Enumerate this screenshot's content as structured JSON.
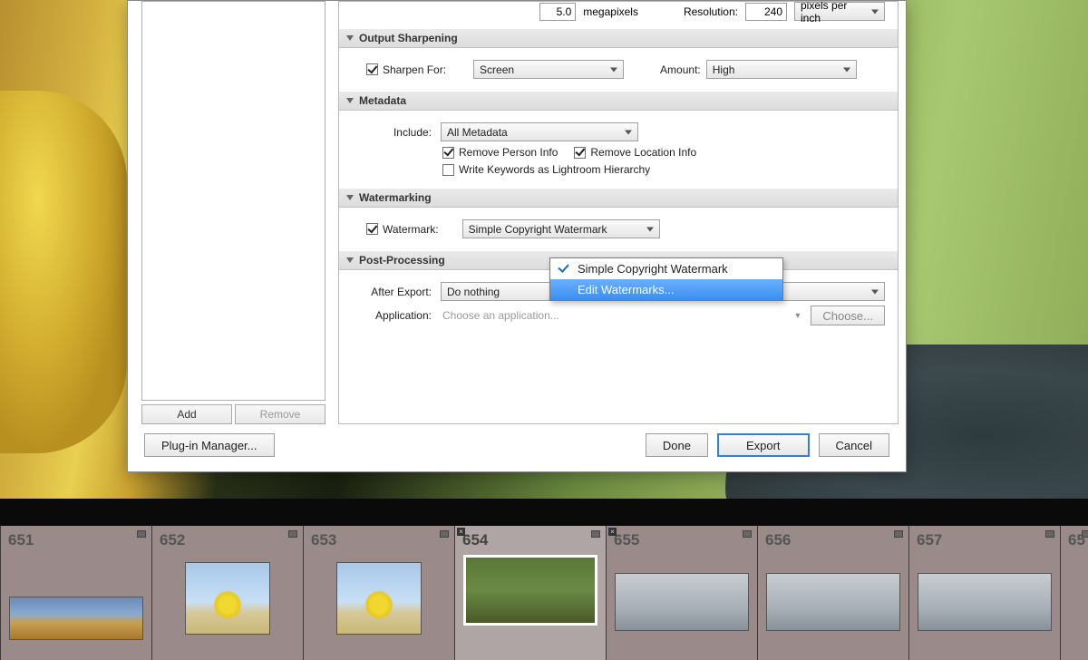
{
  "partial": {
    "megapixels": "5.0",
    "megapixels_label": "megapixels",
    "resolution_label": "Resolution:",
    "resolution": "240",
    "res_unit": "pixels per inch"
  },
  "sharpening": {
    "header": "Output Sharpening",
    "sharpen_label": "Sharpen For:",
    "sharpen_value": "Screen",
    "amount_label": "Amount:",
    "amount_value": "High"
  },
  "metadata": {
    "header": "Metadata",
    "include_label": "Include:",
    "include_value": "All Metadata",
    "remove_person": "Remove Person Info",
    "remove_location": "Remove Location Info",
    "write_keywords": "Write Keywords as Lightroom Hierarchy"
  },
  "watermarking": {
    "header": "Watermarking",
    "watermark_label": "Watermark:",
    "watermark_value": "Simple Copyright Watermark",
    "options": {
      "simple": "Simple Copyright Watermark",
      "edit": "Edit Watermarks..."
    }
  },
  "postprocess": {
    "header": "Post-Processing",
    "after_label": "After Export:",
    "after_value": "Do nothing",
    "app_label": "Application:",
    "app_placeholder": "Choose an application...",
    "choose_btn": "Choose..."
  },
  "preset": {
    "add": "Add",
    "remove": "Remove"
  },
  "footer": {
    "plugin": "Plug-in Manager...",
    "done": "Done",
    "export": "Export",
    "cancel": "Cancel"
  },
  "thumbs": {
    "t651": "651",
    "t652": "652",
    "t653": "653",
    "t654": "654",
    "t655": "655",
    "t656": "656",
    "t657": "657",
    "t658": "65"
  }
}
